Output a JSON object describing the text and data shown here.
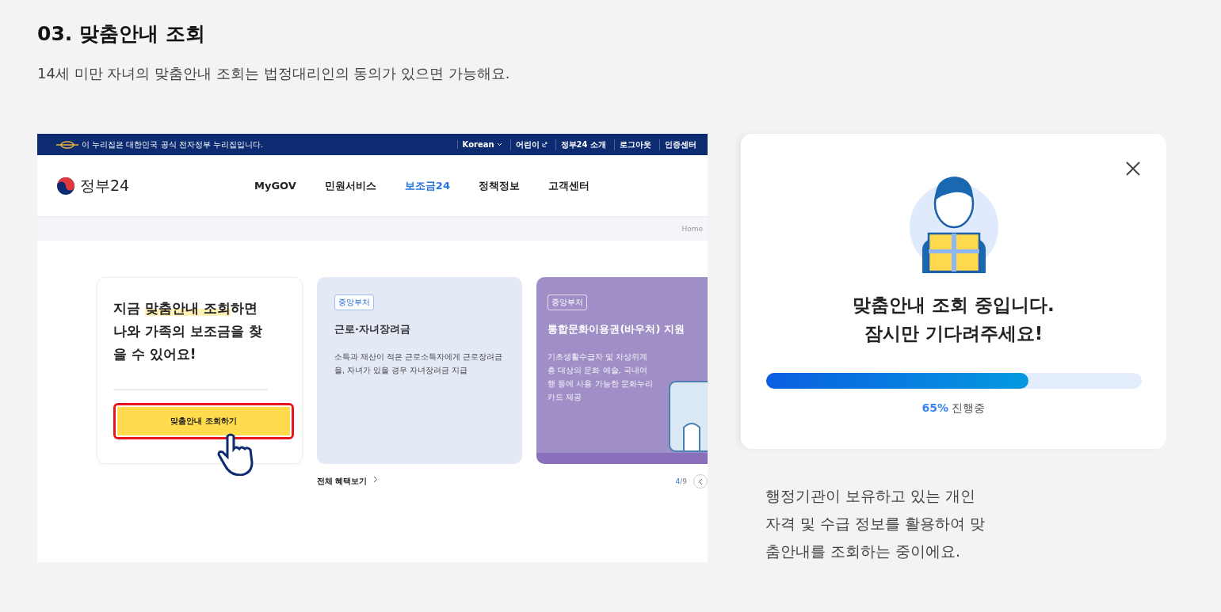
{
  "section": {
    "title": "03. 맞춤안내 조회",
    "description": "14세 미만 자녀의 맞춤안내 조회는 법정대리인의 동의가 있으면 가능해요."
  },
  "site": {
    "notice": "이 누리집은 대한민국 공식 전자정부 누리집입니다.",
    "top_links": [
      {
        "label": "Korean",
        "kind": "dropdown"
      },
      {
        "label": "어린이",
        "kind": "external"
      },
      {
        "label": "정부24 소개",
        "kind": "plain"
      },
      {
        "label": "로그아웃",
        "kind": "plain"
      },
      {
        "label": "인증센터",
        "kind": "plain"
      }
    ],
    "logo": "정부24",
    "nav": [
      {
        "label": "MyGOV",
        "selected": false
      },
      {
        "label": "민원서비스",
        "selected": false
      },
      {
        "label": "보조금24",
        "selected": true
      },
      {
        "label": "정책정보",
        "selected": false
      },
      {
        "label": "고객센터",
        "selected": false
      }
    ],
    "breadcrumb": "Home",
    "promo": {
      "headline_before": "지금 ",
      "headline_highlight": "맞춤안내 조회",
      "headline_after": "하면 나와 가족의 보조금을 찾을 수 있어요!",
      "button": "맞춤안내 조회하기"
    },
    "cards": [
      {
        "kind": "light",
        "tag": "중앙부처",
        "title": "근로·자녀장려금",
        "body": "소득과 재산이 적은 근로소득자에게 근로장려금을, 자녀가 있을 경우 자녀장려금 지급"
      },
      {
        "kind": "purple",
        "tag": "중앙부처",
        "title": "통합문화이용권(바우처) 지원",
        "body": "기초생활수급자 및 차상위계층 대상의 문화 예술, 국내여행 등에 사용 가능한 문화누리카드 제공"
      }
    ],
    "all_link": "전체 혜택보기",
    "pager": {
      "current": "4",
      "total": "/9"
    }
  },
  "popup": {
    "title": "맞춤안내 조회 중입니다. 잠시만 기다려주세요!",
    "level": 0.7,
    "percent": "65%",
    "status": "진행중"
  },
  "caption": "행정기관이 보유하고 있는 개인 자격 및 수급 정보를 활용하여 맞춤안내를 조회하는 중이에요."
}
